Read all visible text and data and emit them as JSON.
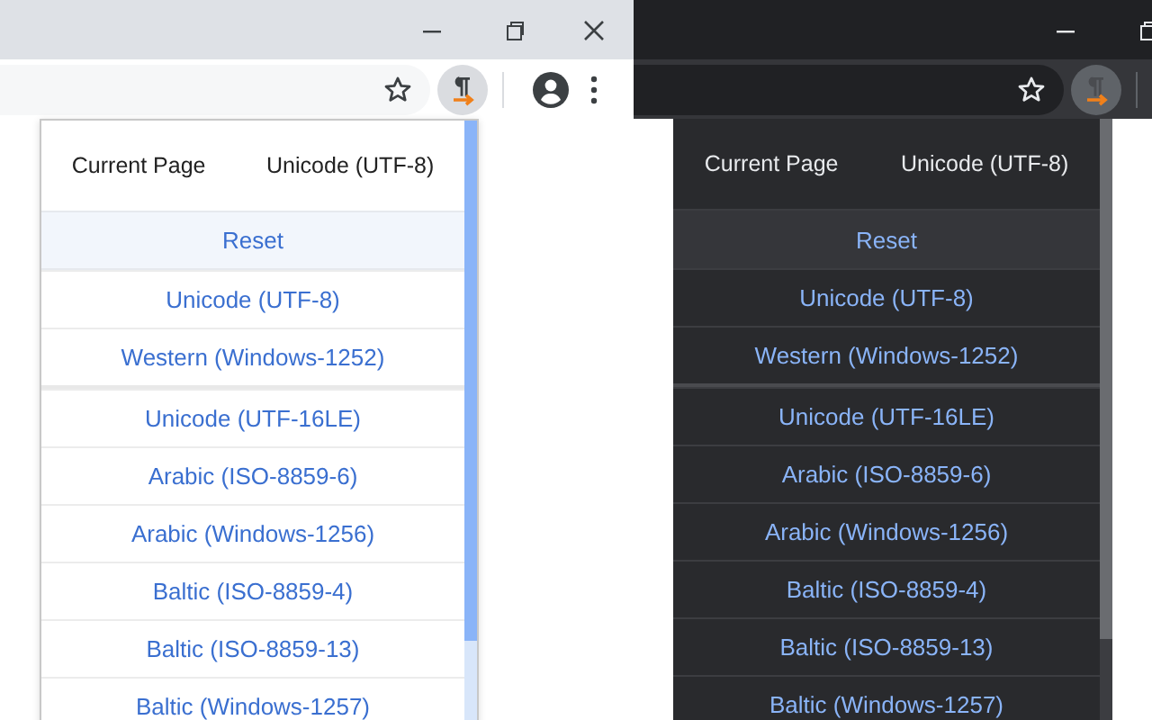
{
  "windows": [
    {
      "dark_mode": false,
      "popup": {
        "current_label": "Current Page",
        "current_value": "Unicode (UTF-8)",
        "reset": "Reset",
        "groups": [
          [
            "Unicode (UTF-8)",
            "Western (Windows-1252)"
          ],
          [
            "Unicode (UTF-16LE)",
            "Arabic (ISO-8859-6)",
            "Arabic (Windows-1256)",
            "Baltic (ISO-8859-4)",
            "Baltic (ISO-8859-13)",
            "Baltic (Windows-1257)"
          ]
        ]
      }
    },
    {
      "dark_mode": true,
      "popup": {
        "current_label": "Current Page",
        "current_value": "Unicode (UTF-8)",
        "reset": "Reset",
        "groups": [
          [
            "Unicode (UTF-8)",
            "Western (Windows-1252)"
          ],
          [
            "Unicode (UTF-16LE)",
            "Arabic (ISO-8859-6)",
            "Arabic (Windows-1256)",
            "Baltic (ISO-8859-4)",
            "Baltic (ISO-8859-13)",
            "Baltic (Windows-1257)"
          ]
        ]
      }
    }
  ]
}
